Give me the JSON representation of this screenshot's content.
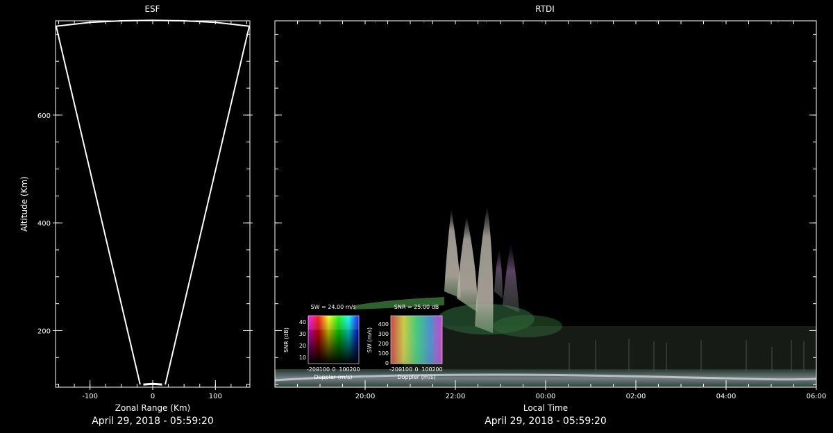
{
  "colors": {
    "background": "#000000",
    "axis": "#ffffff",
    "frame": "#ffffff",
    "rtdi_green": "#5aa25a",
    "rtdi_white": "#cfcfcf",
    "rtdi_purple": "#7a5a88"
  },
  "chart_data": [
    {
      "type": "line",
      "title": "ESF",
      "xlabel": "Zonal Range (Km)",
      "ylabel": "Altitude (Km)",
      "xlim": [
        -155,
        155
      ],
      "ylim": [
        95,
        775
      ],
      "xticks": [
        -100,
        0,
        100
      ],
      "yticks": [
        200,
        400,
        600
      ],
      "tick_labels": {
        "x": [
          "-100",
          "0",
          "100"
        ],
        "y": [
          "200",
          "400",
          "600"
        ]
      },
      "footer": "April 29, 2018 - 05:59:20",
      "series": [
        {
          "values": [
            [
              -20,
              100
            ],
            [
              -154,
              765
            ],
            [
              -100,
              772
            ],
            [
              -50,
              775
            ],
            [
              0,
              776
            ],
            [
              50,
              775
            ],
            [
              100,
              772
            ],
            [
              154,
              765
            ],
            [
              20,
              100
            ]
          ]
        },
        {
          "values": [
            [
              -15,
              100
            ],
            [
              0,
              101
            ],
            [
              15,
              100
            ]
          ]
        }
      ]
    },
    {
      "type": "heatmap",
      "title": "RTDI",
      "xlabel": "Local Time",
      "x_ticks": [
        "20:00",
        "22:00",
        "00:00",
        "02:00",
        "04:00",
        "06:00"
      ],
      "footer": "April 29, 2018 - 05:59:20",
      "insets": [
        {
          "title": "SW = 24.00 m/s",
          "xlabel": "Doppler (m/s)",
          "ylabel": "SNR (dB)",
          "xtick_labels": [
            "-200",
            "-100",
            "0",
            "100",
            "200"
          ],
          "ytick_labels": [
            "10",
            "20",
            "30",
            "40"
          ]
        },
        {
          "title": "SNR = 25.00 dB",
          "xlabel": "Doppler (m/s)",
          "ylabel": "SW (m/s)",
          "xtick_labels": [
            "-200",
            "-100",
            "0",
            "100",
            "200"
          ],
          "ytick_labels": [
            "0",
            "100",
            "200",
            "300",
            "400"
          ]
        }
      ]
    }
  ]
}
